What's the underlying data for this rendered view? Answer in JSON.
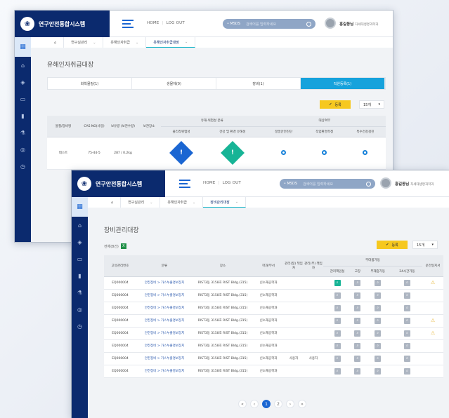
{
  "app": {
    "brand_title": "연구안전통합시스템",
    "logo_glyph": "❀",
    "nav_home": "HOME",
    "nav_sep": "|",
    "nav_logout": "LOG OUT",
    "search_prefix": "• MSDS",
    "search_placeholder": "검색어를 입력하세요",
    "user_name": "홍길동님",
    "user_org": "차세대생명과학과"
  },
  "window1": {
    "breadcrumb": [
      "연구실관리",
      "유해인자취급",
      "유해인자취급대장"
    ],
    "page_title": "유해인자취급대장",
    "segments": [
      "화학물질(1)",
      "생물체(0)",
      "장비(1)",
      "직원등록(1)"
    ],
    "register_label": "등록",
    "per_page": "15개",
    "headers": {
      "name": "물질/장비명",
      "cas": "CAS NO(사양)",
      "qty": "보유량 (보관수량)",
      "location": "보관장소",
      "hazard_group": "유해·위험성 분류",
      "hazard_physical": "물리적위험성",
      "hazard_health": "건강 및 환경 유해성",
      "target_group": "대상여부",
      "target_1": "정밀안전진단",
      "target_2": "작업환경측정",
      "target_3": "특수건강검진"
    },
    "row": {
      "name": "테스트",
      "cas": "75-44-5",
      "qty": "287 / 0.2kg",
      "location": "",
      "glyph_physical": "!",
      "glyph_health": "!"
    }
  },
  "window2": {
    "breadcrumb": [
      "연구실관리",
      "유해인자취급",
      "장비관리대장"
    ],
    "page_title": "장비관리대장",
    "total_label": "전체(8건)",
    "excel_glyph": "X",
    "register_label": "등록",
    "per_page": "15개",
    "headers": {
      "mgmt_no": "고유관리번호",
      "category": "분류",
      "place": "장소",
      "dept": "학과/부서",
      "manager": "관리(정) 책임자",
      "sub_manager": "관리(부) 책임자",
      "accessory_group": "부대품가동",
      "acc_1": "관리책임실",
      "acc_2": "고장",
      "acc_3": "부재중가동",
      "acc_4": "24시간가동",
      "warn": "운전일지서"
    },
    "rows": [
      {
        "no": "EQ000004",
        "cat": "안전장비 > 가스누출경보장치",
        "place": "RIST3동 3158호 RIST Bldg.(315)",
        "dept": "신소재공학과",
        "mgr": "",
        "sub": "",
        "warn": "⚠"
      },
      {
        "no": "EQ000004",
        "cat": "안전장비 > 가스누출경보장치",
        "place": "RIST3동 3158호 RIST Bldg.(315)",
        "dept": "신소재공학과",
        "mgr": "",
        "sub": "",
        "warn": ""
      },
      {
        "no": "EQ000004",
        "cat": "안전장비 > 가스누출경보장치",
        "place": "RIST3동 3158호 RIST Bldg.(315)",
        "dept": "신소재공학과",
        "mgr": "",
        "sub": "",
        "warn": ""
      },
      {
        "no": "EQ000004",
        "cat": "안전장비 > 가스누출경보장치",
        "place": "RIST3동 3158호 RIST Bldg.(315)",
        "dept": "신소재공학과",
        "mgr": "",
        "sub": "",
        "warn": "⚠"
      },
      {
        "no": "EQ000004",
        "cat": "안전장비 > 가스누출경보장치",
        "place": "RIST3동 3158호 RIST Bldg.(315)",
        "dept": "신소재공학과",
        "mgr": "",
        "sub": "",
        "warn": "⚠"
      },
      {
        "no": "EQ000004",
        "cat": "안전장비 > 가스누출경보장치",
        "place": "RIST3동 3158호 RIST Bldg.(315)",
        "dept": "신소재공학과",
        "mgr": "",
        "sub": "",
        "warn": ""
      },
      {
        "no": "EQ000004",
        "cat": "안전장비 > 가스누출경보장치",
        "place": "RIST3동 3158호 RIST Bldg.(315)",
        "dept": "신소재공학과",
        "mgr": "사용자",
        "sub": "사용자",
        "warn": ""
      },
      {
        "no": "EQ000004",
        "cat": "안전장비 > 가스누출경보장치",
        "place": "RIST3동 3158호 RIST Bldg.(315)",
        "dept": "신소재공학과",
        "mgr": "",
        "sub": "",
        "warn": ""
      }
    ],
    "pager": [
      "«",
      "‹",
      "1",
      "2",
      "›",
      "»"
    ]
  },
  "colors": {
    "navy": "#0b2a6e",
    "accent": "#16a2dc",
    "yellow": "#f6c81f",
    "hazard_blue": "#1b66d2",
    "hazard_teal": "#17b496"
  }
}
